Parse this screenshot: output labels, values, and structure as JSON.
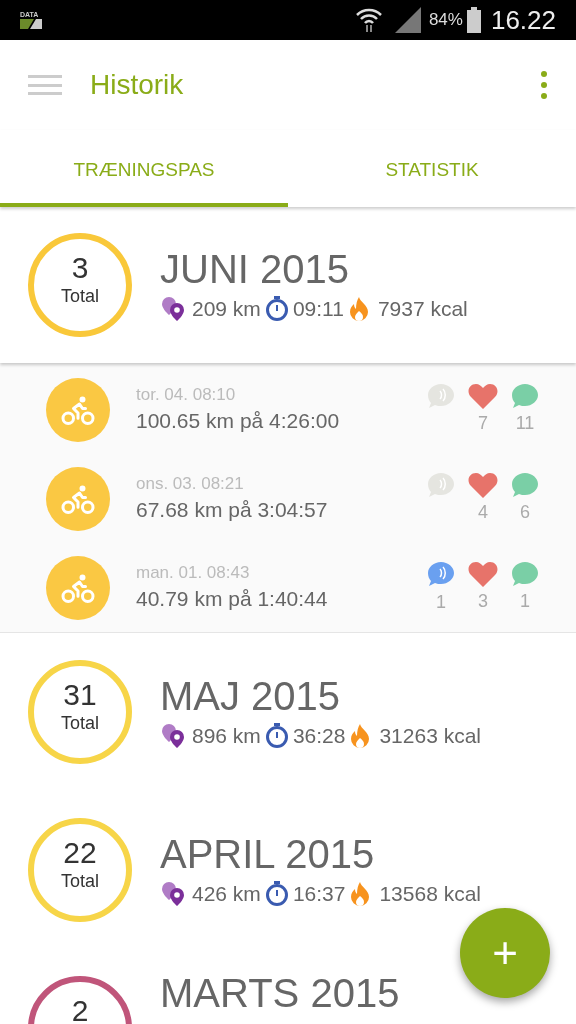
{
  "status_bar": {
    "data_label": "DATA",
    "battery": "84%",
    "time": "16.22"
  },
  "app_bar": {
    "title": "Historik"
  },
  "tabs": [
    {
      "label": "TRÆNINGSPAS",
      "selected": true
    },
    {
      "label": "STATISTIK",
      "selected": false
    }
  ],
  "months": [
    {
      "count": "3",
      "count_label": "Total",
      "title": "JUNI 2015",
      "distance": "209 km",
      "duration": "09:11",
      "calories": "7937 kcal",
      "color": "#f9c83a",
      "expanded": true,
      "activities": [
        {
          "date": "tor. 04. 08:10",
          "summary": "100.65 km på 4:26:00",
          "cheered": false,
          "likes": "7",
          "comments": "11"
        },
        {
          "date": "ons. 03. 08:21",
          "summary": "67.68 km på 3:04:57",
          "cheered": false,
          "likes": "4",
          "comments": "6"
        },
        {
          "date": "man. 01. 08:43",
          "summary": "40.79 km på 1:40:44",
          "cheered": true,
          "cheers": "1",
          "likes": "3",
          "comments": "1"
        }
      ]
    },
    {
      "count": "31",
      "count_label": "Total",
      "title": "MAJ 2015",
      "distance": "896 km",
      "duration": "36:28",
      "calories": "31263 kcal",
      "color": "#f7d548",
      "expanded": false
    },
    {
      "count": "22",
      "count_label": "Total",
      "title": "APRIL 2015",
      "distance": "426 km",
      "duration": "16:37",
      "calories": "13568 kcal",
      "color": "#f7d548",
      "expanded": false
    },
    {
      "count": "2",
      "title": "MARTS 2015",
      "color": "#c0557a",
      "expanded": false
    }
  ],
  "fab": {
    "label": "+"
  }
}
